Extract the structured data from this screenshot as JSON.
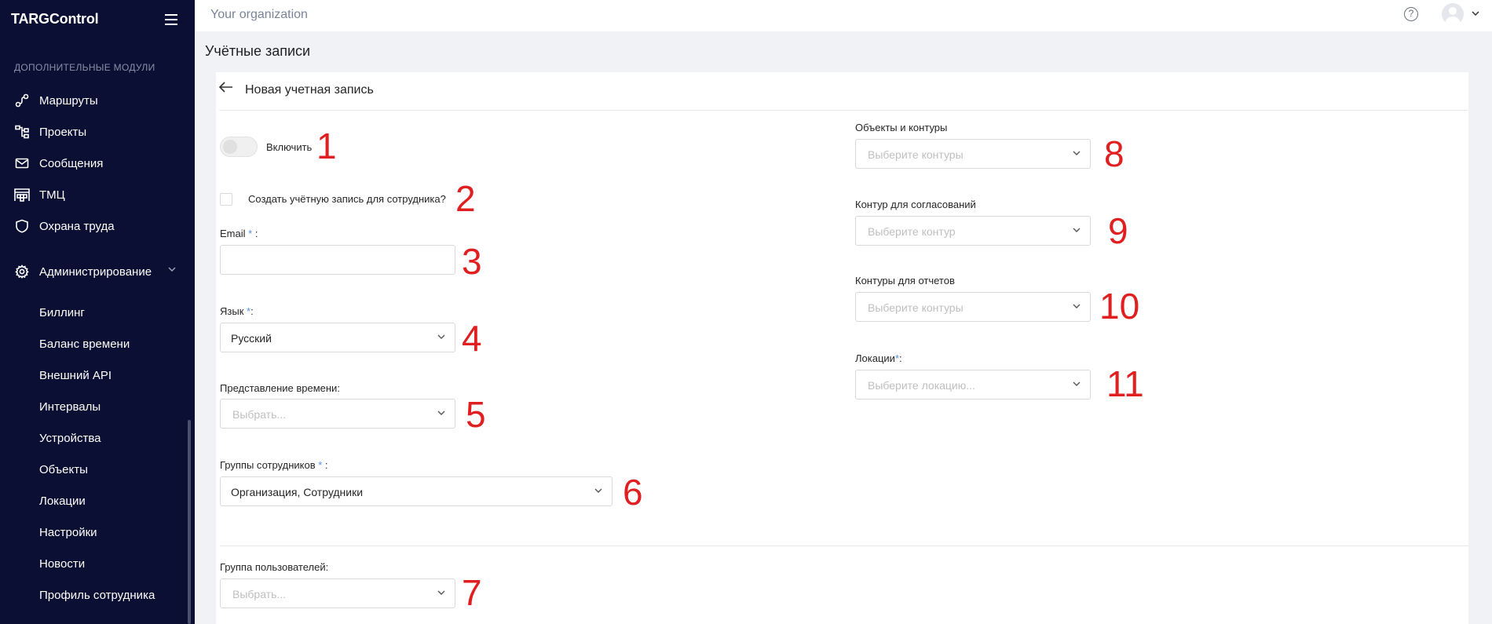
{
  "sidebar": {
    "logo": "TARGControl",
    "section_label": "ДОПОЛНИТЕЛЬНЫЕ МОДУЛИ",
    "items": [
      {
        "label": "Маршруты",
        "icon": "route-icon"
      },
      {
        "label": "Проекты",
        "icon": "project-tree-icon"
      },
      {
        "label": "Сообщения",
        "icon": "envelope-icon"
      },
      {
        "label": "ТМЦ",
        "icon": "warehouse-icon"
      },
      {
        "label": "Охрана труда",
        "icon": "shield-icon"
      }
    ],
    "admin": {
      "label": "Администрирование",
      "icon": "gear-icon"
    },
    "sub_items": [
      "Биллинг",
      "Баланс времени",
      "Внешний API",
      "Интервалы",
      "Устройства",
      "Объекты",
      "Локации",
      "Настройки",
      "Новости",
      "Профиль сотрудника"
    ]
  },
  "header": {
    "organization": "Your organization",
    "help_symbol": "?"
  },
  "page_title": "Учётные записи",
  "form": {
    "title": "Новая учетная запись",
    "enable_label": "Включить",
    "employee_checkbox_label": "Создать учётную запись для сотрудника?",
    "email_label": "Email",
    "email_label_suffix": " :",
    "email_value": "",
    "language_label": "Язык",
    "language_label_suffix": ":",
    "language_value": "Русский",
    "time_label": "Представление времени:",
    "time_placeholder": "Выбрать...",
    "groups_label": "Группы сотрудников",
    "groups_label_suffix": " :",
    "groups_value": "Организация, Сотрудники",
    "user_group_label": "Группа пользователей:",
    "user_group_placeholder": "Выбрать...",
    "objects_label": "Объекты и контуры",
    "objects_placeholder": "Выберите контуры",
    "approval_label": "Контур для согласований",
    "approval_placeholder": "Выберите контур",
    "reports_label": "Контуры для отчетов",
    "reports_placeholder": "Выберите контуры",
    "locations_label": "Локации",
    "locations_label_suffix": ":",
    "locations_placeholder": "Выберите локацию...",
    "required_mark": "*"
  },
  "annotations": [
    "1",
    "2",
    "3",
    "4",
    "5",
    "6",
    "7",
    "8",
    "9",
    "10",
    "11"
  ]
}
